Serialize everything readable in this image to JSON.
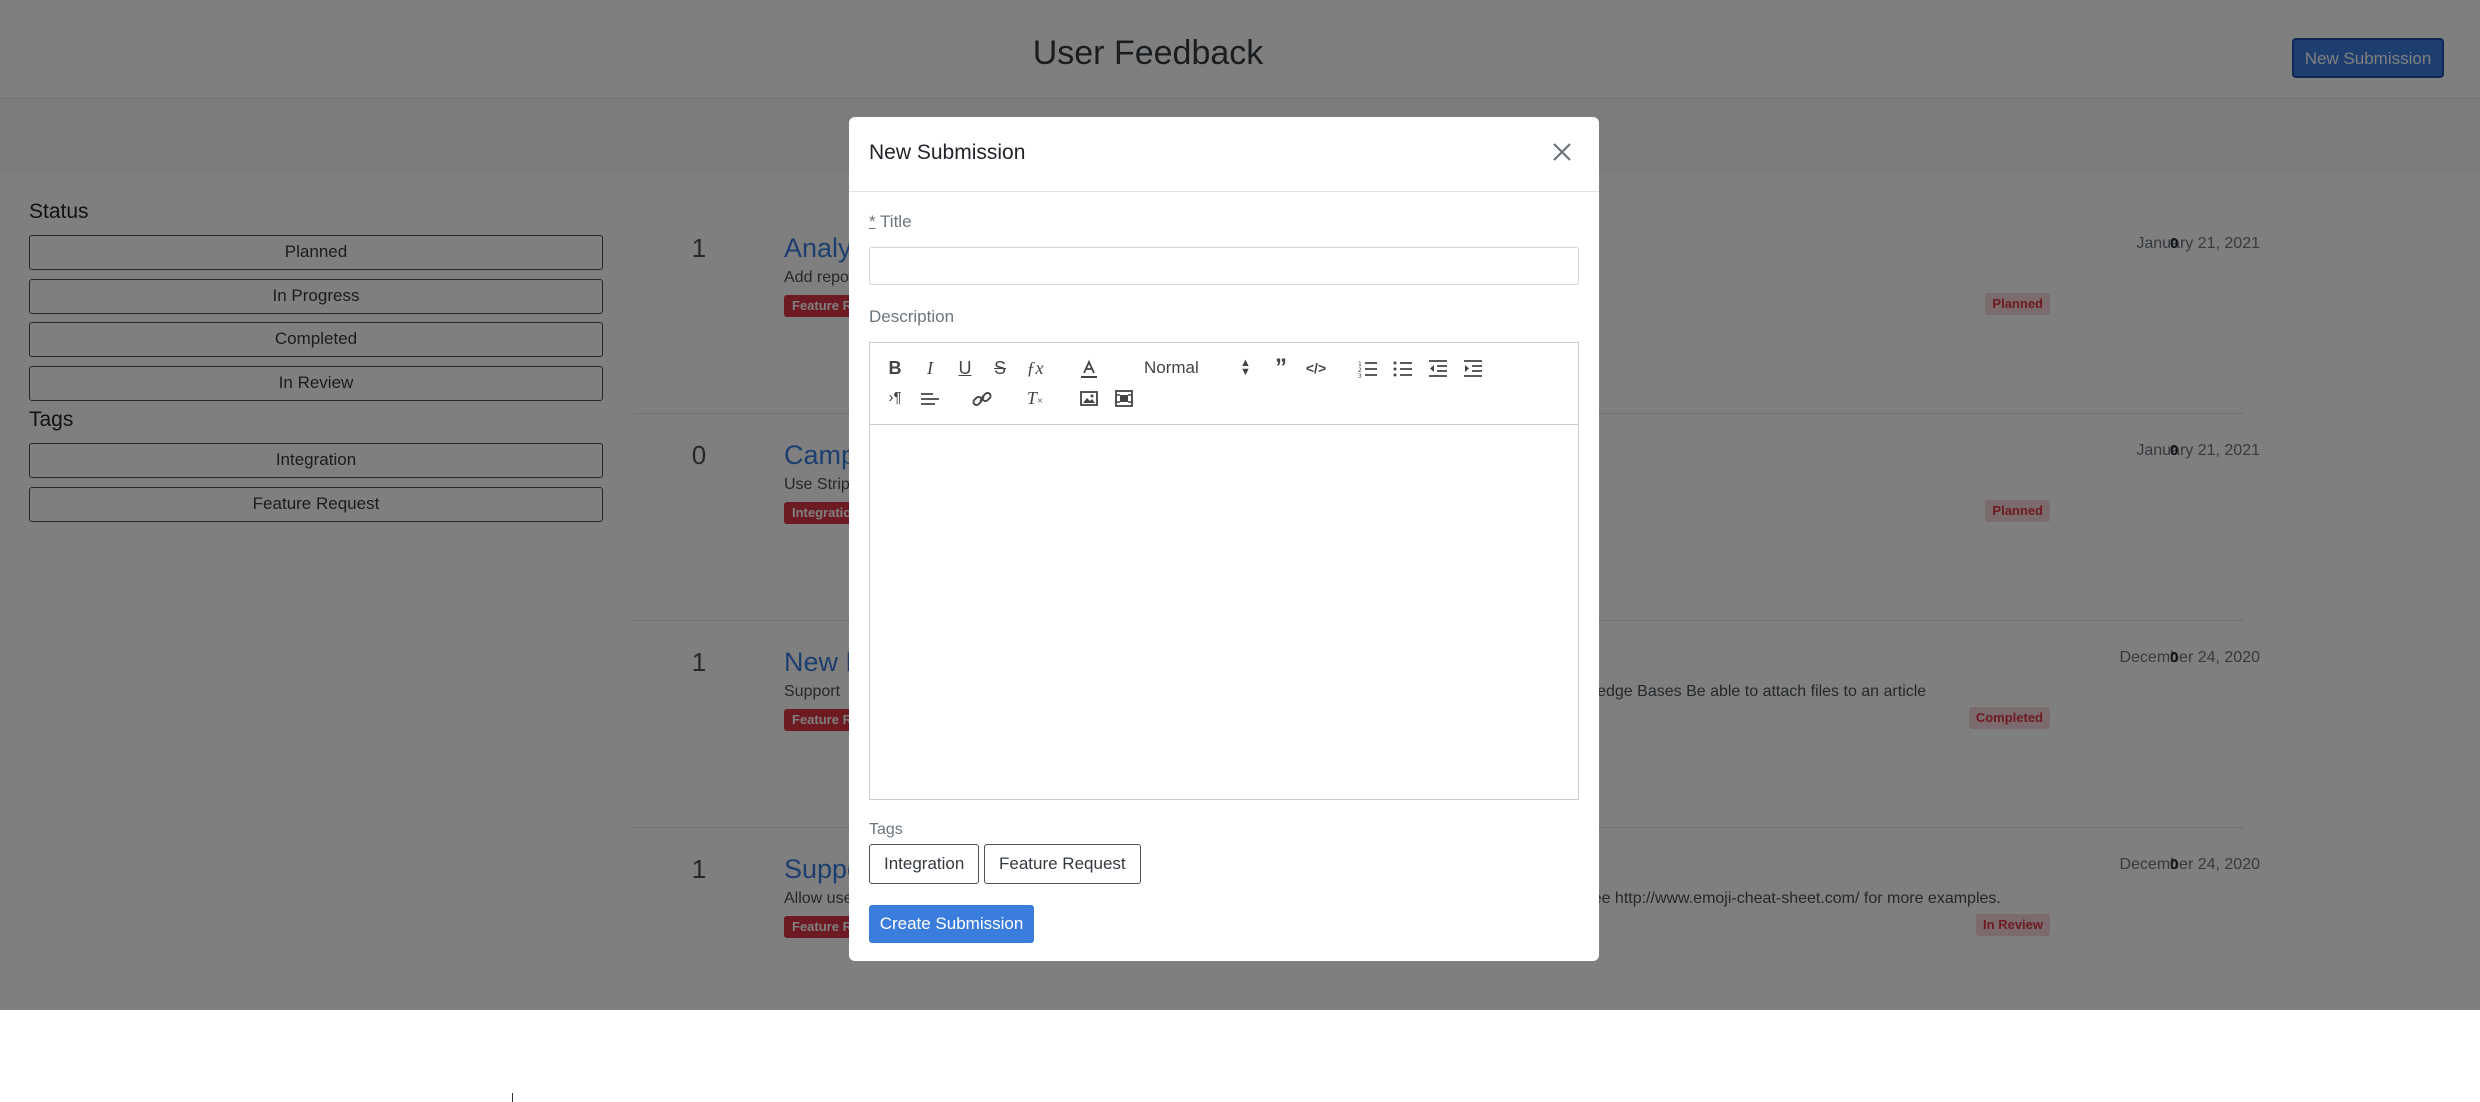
{
  "header": {
    "title": "User Feedback",
    "new_submission_label": "New Submission"
  },
  "sidebar": {
    "status_heading": "Status",
    "status_items": [
      "Planned",
      "In Progress",
      "Completed",
      "In Review"
    ],
    "tags_heading": "Tags",
    "tag_items": [
      "Integration",
      "Feature Request"
    ]
  },
  "posts": [
    {
      "votes": "1",
      "title": "Analy",
      "desc": "Add repo",
      "tag": "Feature Re",
      "date": "January 21, 2021",
      "count": "0",
      "status": "Planned",
      "desc_tail": ""
    },
    {
      "votes": "0",
      "title": "Camp",
      "desc": "Use Strip",
      "tag": "Integratio",
      "date": "January 21, 2021",
      "count": "0",
      "status": "Planned",
      "desc_tail": ""
    },
    {
      "votes": "1",
      "title": "New F",
      "desc": "Support",
      "tag": "Feature Re",
      "date": "December 24, 2020",
      "count": "0",
      "status": "Completed",
      "desc_tail": "wledge Bases Be able to attach files to an article"
    },
    {
      "votes": "1",
      "title": "Suppo",
      "desc": "Allow use",
      "tag": "Feature Re",
      "date": "December 24, 2020",
      "count": "0",
      "status": "In Review",
      "desc_tail": "See http://www.emoji-cheat-sheet.com/ for more examples."
    }
  ],
  "modal": {
    "title": "New Submission",
    "title_field_required": "*",
    "title_field_label": " Title",
    "title_value": "",
    "description_label": "Description",
    "format_select_value": "Normal",
    "tags_label": "Tags",
    "tag_options": [
      "Integration",
      "Feature Request"
    ],
    "create_label": "Create Submission"
  },
  "icons": {
    "close": "close-icon",
    "bold": "bold-icon",
    "italic": "italic-icon",
    "underline": "underline-icon",
    "strike": "strikethrough-icon",
    "formula": "formula-icon",
    "color": "text-color-icon",
    "quote": "blockquote-icon",
    "code": "code-icon",
    "ol": "ordered-list-icon",
    "ul": "bullet-list-icon",
    "outdent": "outdent-icon",
    "indent": "indent-icon",
    "direction": "text-direction-icon",
    "align": "align-icon",
    "link": "link-icon",
    "clean": "clear-format-icon",
    "image": "image-icon",
    "video": "video-icon"
  },
  "colors": {
    "accent": "#3b7ddd",
    "danger": "#dc3545",
    "overlay": "rgba(0,0,0,0.5)"
  }
}
